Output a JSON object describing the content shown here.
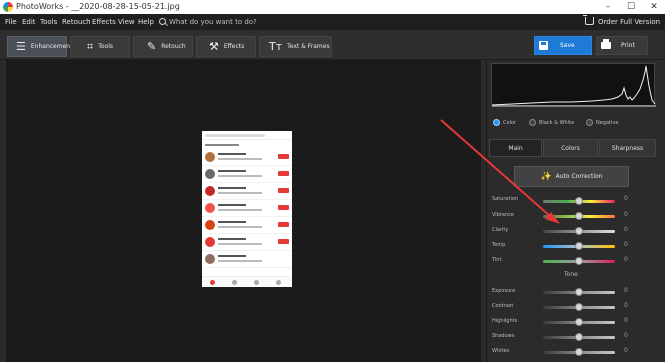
{
  "window": {
    "title": "PhotoWorks - __2020-08-28-15-05-21.jpg",
    "minimize_glyph": "–",
    "maximize_glyph": "☐",
    "close_glyph": "✕"
  },
  "menu": {
    "items": [
      "File",
      "Edit",
      "Tools",
      "Retouch",
      "Effects",
      "View",
      "Help"
    ],
    "search_placeholder": "What do you want to do?",
    "order_label": "Order Full Version"
  },
  "toolbar": {
    "tabs": [
      {
        "label": "Enhancement",
        "icon": "sliders-icon",
        "glyph": "☰"
      },
      {
        "label": "Tools",
        "icon": "crop-icon",
        "glyph": "⌗"
      },
      {
        "label": "Retouch",
        "icon": "brush-icon",
        "glyph": "✎"
      },
      {
        "label": "Effects",
        "icon": "magic-wand-icon",
        "glyph": "⚒"
      },
      {
        "label": "Text & Frames",
        "icon": "text-icon",
        "glyph": "Tт"
      }
    ],
    "save_label": "Save",
    "print_label": "Print"
  },
  "panel": {
    "modes": [
      {
        "label": "Color",
        "selected": true
      },
      {
        "label": "Black & White",
        "selected": false
      },
      {
        "label": "Negative",
        "selected": false
      }
    ],
    "tabs": [
      "Main",
      "Colors",
      "Sharpness"
    ],
    "auto_correction_label": "Auto Correction",
    "adjustments": [
      {
        "label": "Saturation",
        "value": "0"
      },
      {
        "label": "Vibrance",
        "value": "0"
      },
      {
        "label": "Clarity",
        "value": "0"
      },
      {
        "label": "Temp",
        "value": "0"
      },
      {
        "label": "Tint",
        "value": "0"
      }
    ],
    "tone_section_label": "Tone",
    "tone_adjustments": [
      {
        "label": "Exposure",
        "value": "0"
      },
      {
        "label": "Contrast",
        "value": "0"
      },
      {
        "label": "Highlights",
        "value": "0"
      },
      {
        "label": "Shadows",
        "value": "0"
      },
      {
        "label": "Whites",
        "value": "0"
      }
    ]
  },
  "colors": {
    "accent": "#1f7ad6",
    "annotation_arrow": "#e53935"
  }
}
